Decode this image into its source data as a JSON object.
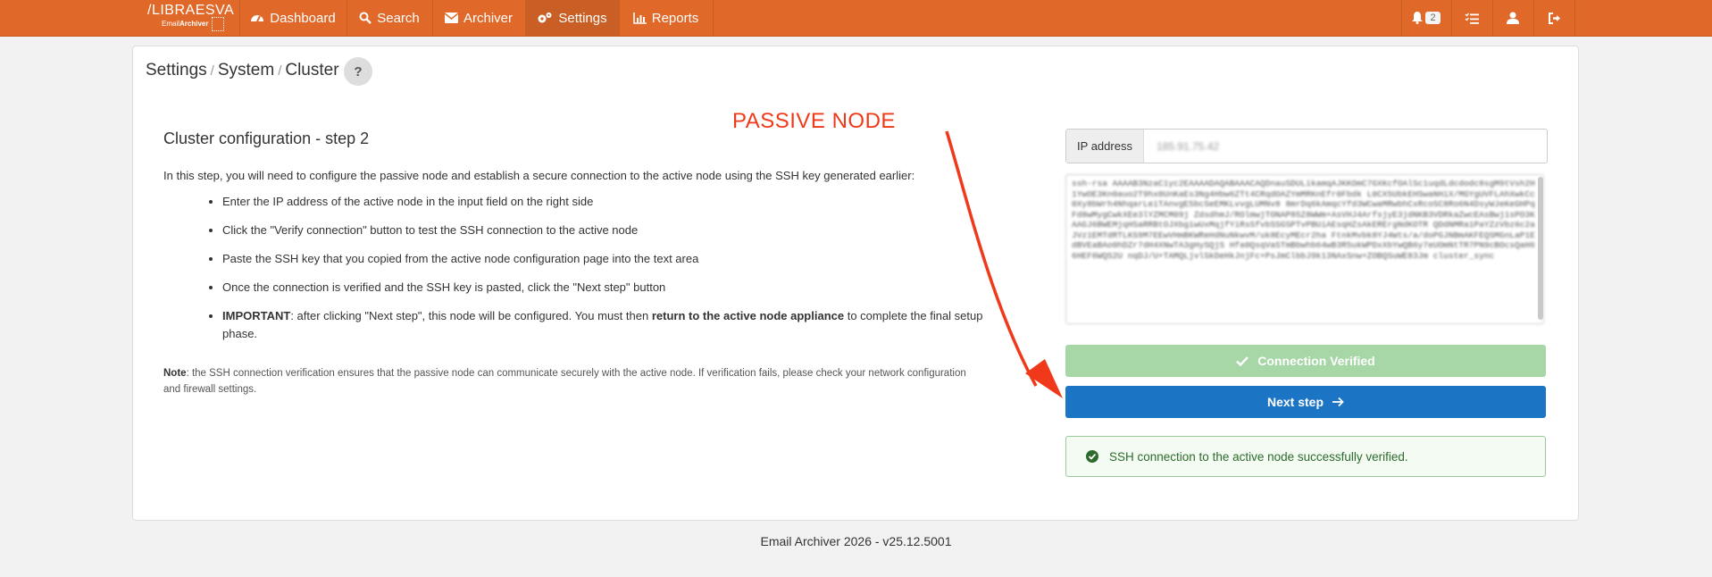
{
  "brand": {
    "name": "/LIBRAESVA",
    "sub_prefix": "Email",
    "sub_bold": "Archiver"
  },
  "nav": {
    "items": [
      {
        "label": "Dashboard",
        "icon": "dashboard-icon"
      },
      {
        "label": "Search",
        "icon": "search-icon"
      },
      {
        "label": "Archiver",
        "icon": "envelope-icon"
      },
      {
        "label": "Settings",
        "icon": "gears-icon",
        "active": true
      },
      {
        "label": "Reports",
        "icon": "chart-icon"
      }
    ],
    "notifications_count": "2"
  },
  "breadcrumb": {
    "part1": "Settings",
    "part2": "System",
    "part3": "Cluster",
    "separator": "/"
  },
  "help_label": "?",
  "main": {
    "title": "Cluster configuration - step 2",
    "intro": "In this step, you will need to configure the passive node and establish a secure connection to the active node using the SSH key generated earlier:",
    "steps": [
      "Enter the IP address of the active node in the input field on the right side",
      "Click the \"Verify connection\" button to test the SSH connection to the active node",
      "Paste the SSH key that you copied from the active node configuration page into the text area",
      "Once the connection is verified and the SSH key is pasted, click the \"Next step\" button"
    ],
    "important_label": "IMPORTANT",
    "important_text_1": ": after clicking \"Next step\", this node will be configured. You must then ",
    "important_bold": "return to the active node appliance",
    "important_text_2": " to complete the final setup phase.",
    "note_label": "Note",
    "note_text": ": the SSH connection verification ensures that the passive node can communicate securely with the active node. If verification fails, please check your network configuration and firewall settings."
  },
  "form": {
    "ip_label": "IP address",
    "ip_value": "185.91.75.42",
    "ssh_key": "ssh-rsa AAAAB3NzaC1yc2EAAAADAQABAAACAQDnauSDULikamqAJKKOmC7GXKcfOAlSc1uqdLdcdodc8sgM9tVsh2H1YwOE3Kn0auo2T9hx0UnKaEs3Ng4Hbw6ZTt4CRqdOAZYmMRKnEfr0Fbdk L0CX5UbkEHSwaNHiX/MGYgUVFLAhXwkCc0Xy8bWrh4NhqarLeiTAnvgE5bcSeEMKLvvgLUMNv8 8mrDq6kAmqcYfd3WCwaMRwbhCxRcoSC8Ro6N4DsyWJeKeGHPqFd8wMygCwkXEe3lYZMCM09j ZdsdhmJ/ROlmwjTONAP85Z8WWm+AsVHJ4ArfsjyE3jdNKB3VDRkaZwcEAsBwj1sPO3KAAGJ6BWEMjqHSaRRBtOJXbgiwUxMqjfYiRsSfvbSSGSPTvPBUiAEsqHZsAkERErgNdKOTR QDdNMRa1PaYZzVbz6c2aJVz1EMTdRTLKS9M7EEwVHmBKWReHdNuNkwvM/uk8EcyMEcr2ha FtnkMvbk8YJ4Wts/a/doPGJNBmAKFEQSMGnLaP1EdBVEaBAo0hDZr7dH4XNwTA3gHySQjS Hfa0QsqVaSTmBbwhb64wB3R5ukWPDxXbYwQB6y7eUOmNtTR7PN9cBOcsQaH66HEF6WQS2U nqDJ/U+TAMQLjvlSkDeHkJnjFc+PsJmClbbJ9k13NAxSnw+ZOBQSuWE83Jm cluster_sync"
  },
  "buttons": {
    "verified": "Connection Verified",
    "next": "Next step"
  },
  "alert": "SSH connection to the active node successfully verified.",
  "annotation": "PASSIVE NODE",
  "footer": "Email Archiver 2026 - v25.12.5001"
}
